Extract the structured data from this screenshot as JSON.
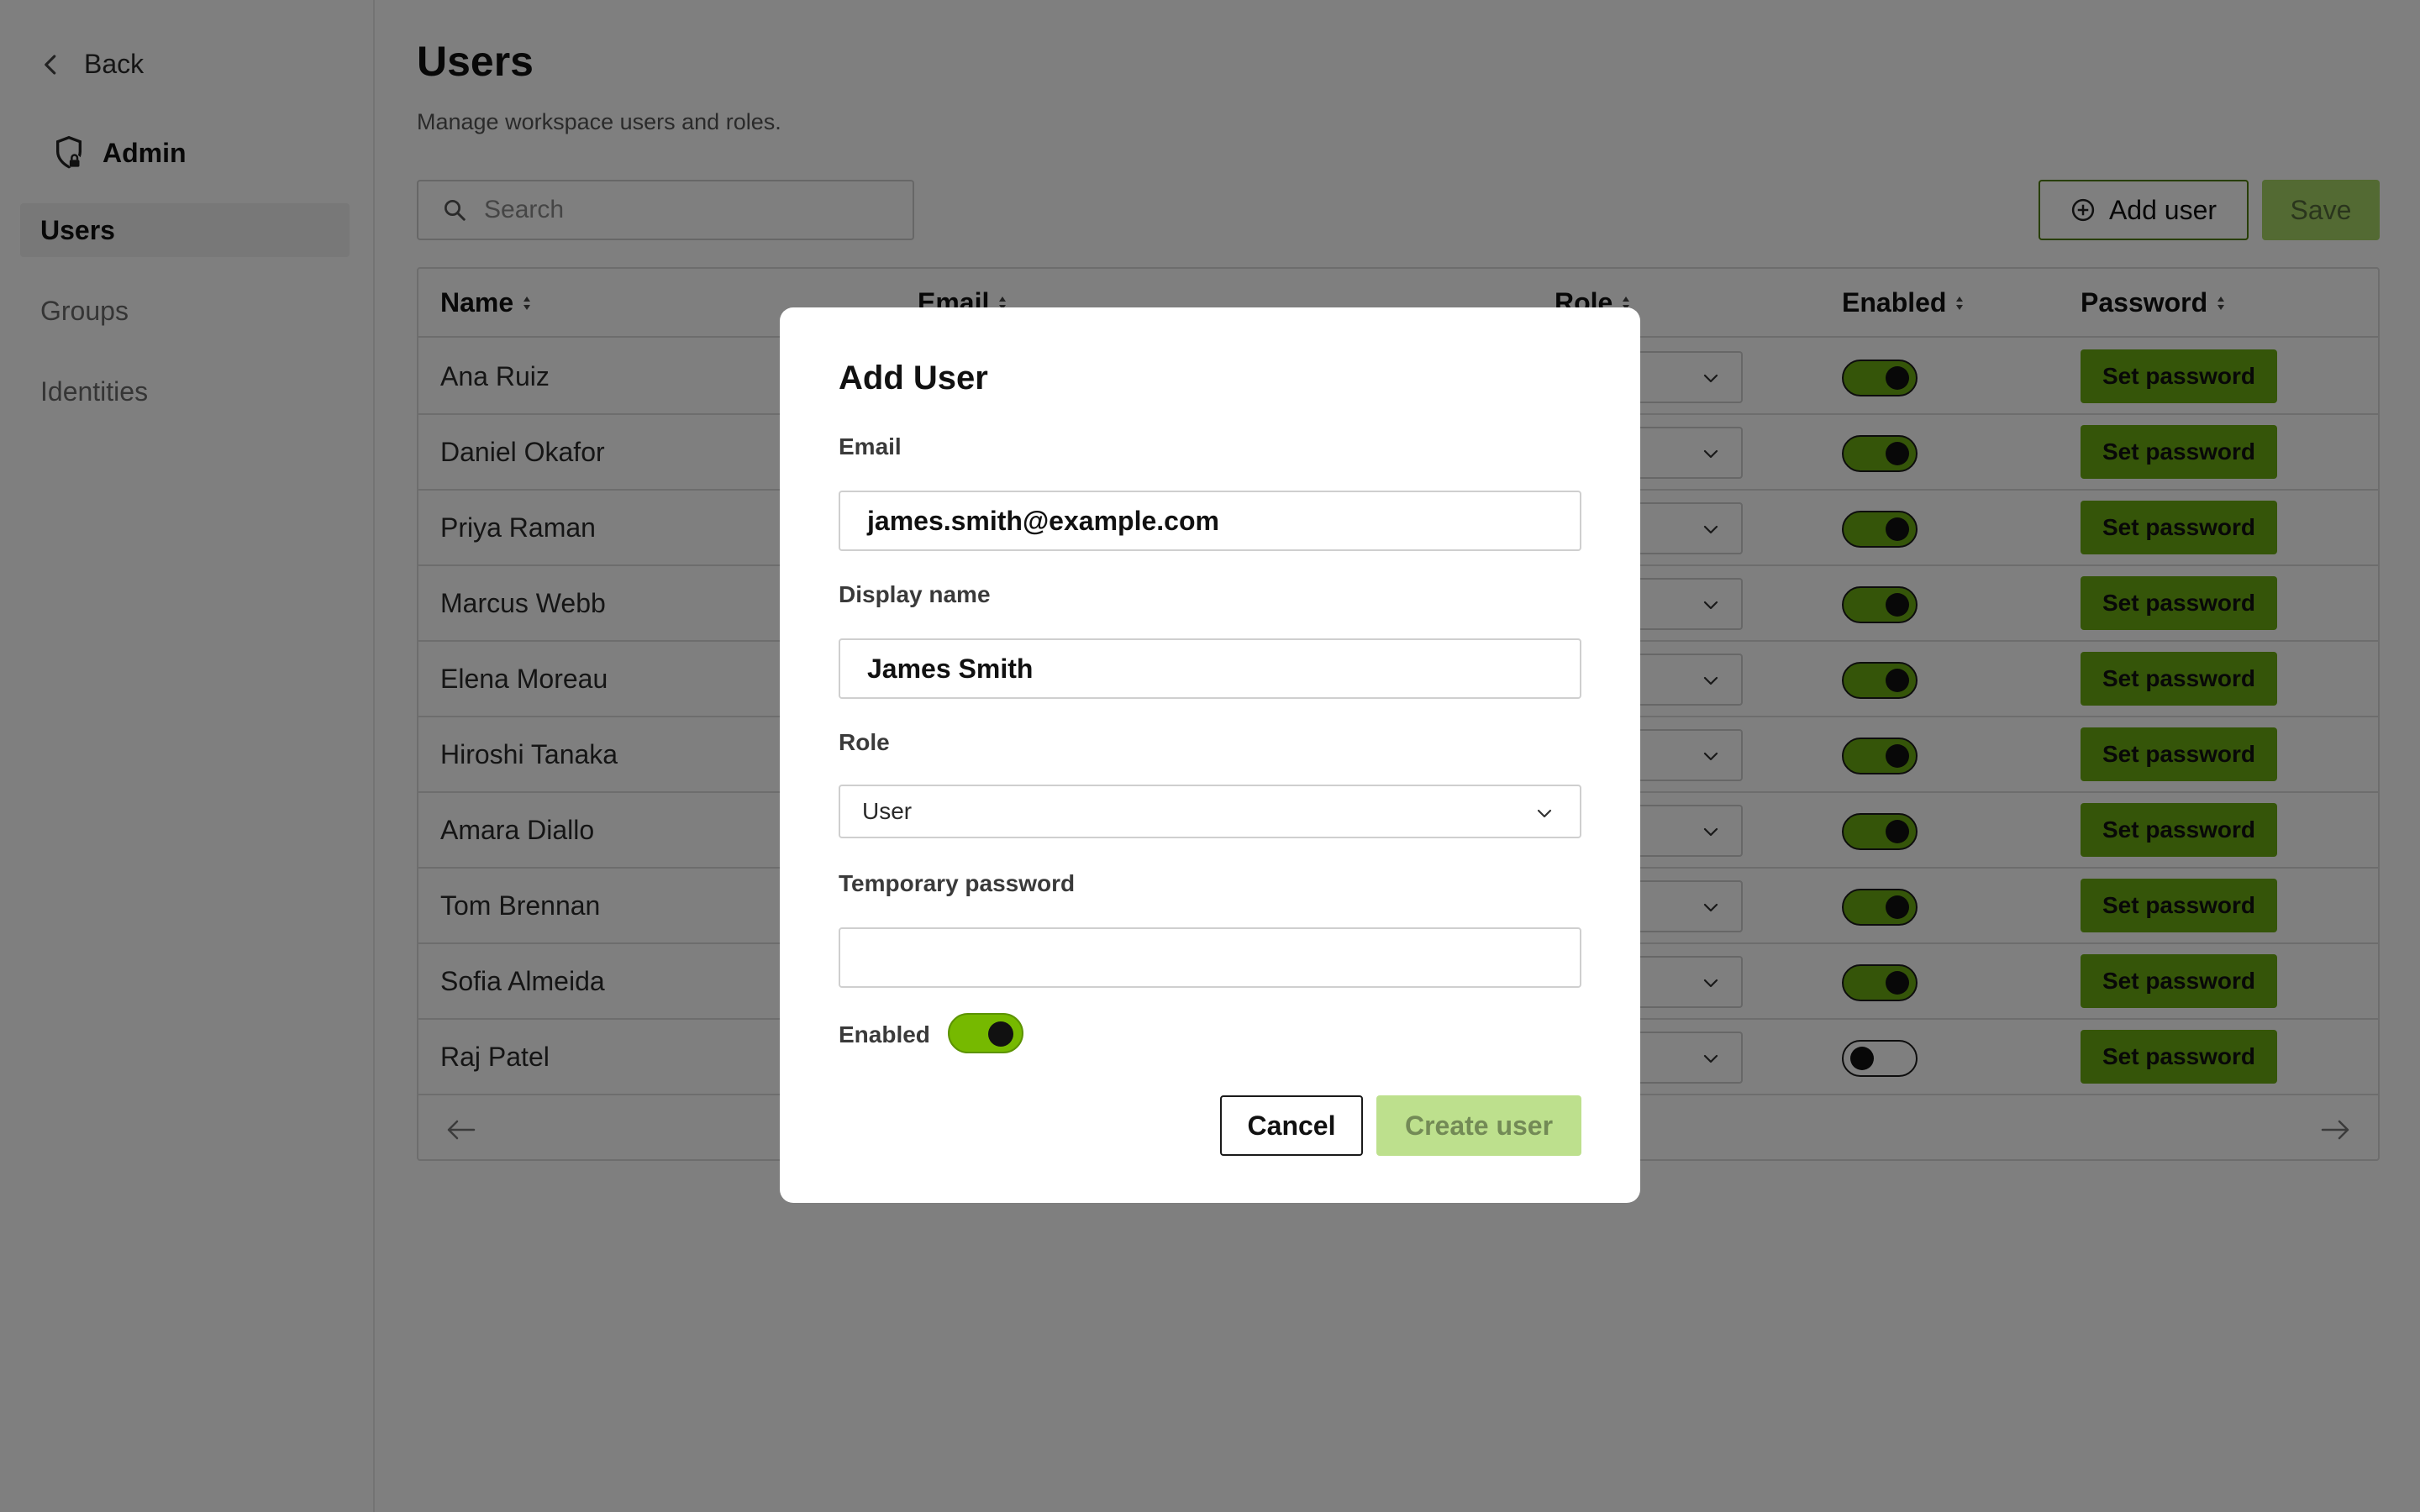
{
  "sidebar": {
    "back_label": "Back",
    "section_title": "Admin",
    "items": [
      {
        "label": "Users",
        "active": true
      },
      {
        "label": "Groups",
        "active": false
      },
      {
        "label": "Identities",
        "active": false
      }
    ]
  },
  "header": {
    "title": "Users",
    "subtitle": "Manage workspace users and roles."
  },
  "toolbar": {
    "search_placeholder": "Search",
    "add_user_label": "Add user",
    "save_label": "Save"
  },
  "table": {
    "columns": [
      "Name",
      "Email",
      "Role",
      "Enabled",
      "Password"
    ],
    "rows": [
      {
        "name": "Ana Ruiz",
        "enabled": true,
        "password_button": "Set password"
      },
      {
        "name": "Daniel Okafor",
        "enabled": true,
        "password_button": "Set password"
      },
      {
        "name": "Priya Raman",
        "enabled": true,
        "password_button": "Set password"
      },
      {
        "name": "Marcus Webb",
        "enabled": true,
        "password_button": "Set password"
      },
      {
        "name": "Elena Moreau",
        "enabled": true,
        "password_button": "Set password"
      },
      {
        "name": "Hiroshi Tanaka",
        "enabled": true,
        "password_button": "Set password"
      },
      {
        "name": "Amara Diallo",
        "enabled": true,
        "password_button": "Set password"
      },
      {
        "name": "Tom Brennan",
        "enabled": true,
        "password_button": "Set password"
      },
      {
        "name": "Sofia Almeida",
        "enabled": true,
        "password_button": "Set password"
      },
      {
        "name": "Raj Patel",
        "enabled": false,
        "password_button": "Set password"
      }
    ]
  },
  "modal": {
    "title": "Add User",
    "email_label": "Email",
    "email_value": "james.smith@example.com",
    "display_name_label": "Display name",
    "display_name_value": "James Smith",
    "role_label": "Role",
    "role_value": "User",
    "temp_password_label": "Temporary password",
    "temp_password_value": "",
    "enabled_label": "Enabled",
    "enabled": true,
    "cancel_label": "Cancel",
    "create_label": "Create user"
  },
  "colors": {
    "accent": "#76b900",
    "accent_dark": "#4f7d00",
    "accent_disabled": "#bde08d",
    "overlay": "rgba(0,0,0,0.5)"
  }
}
